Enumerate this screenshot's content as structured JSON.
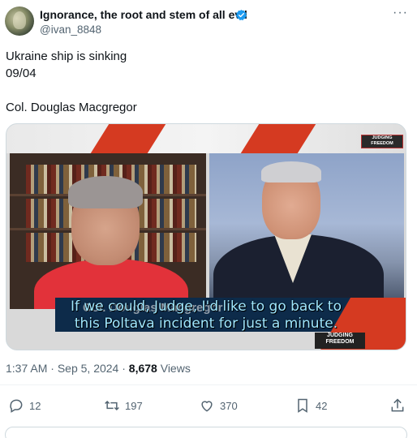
{
  "author": {
    "display_name": "Ignorance, the root and stem of all evil",
    "handle": "@ivan_8848",
    "verified": true
  },
  "menu": {
    "more_icon": "more-horizontal-icon",
    "more_label": "···"
  },
  "tweet": {
    "lines": [
      "Ukraine ship is sinking",
      "09/04",
      "Col. Douglas Macgregor"
    ]
  },
  "media": {
    "type": "video-still",
    "logo_top": "JUDGING FREEDOM",
    "lower_third_name": "Col. Douglas Macgregor",
    "subtitle_line1": "If we could, Judge, I'd like to go back to",
    "subtitle_line2": "this Poltava incident for just a minute.",
    "logo_bottom": "JUDGING FREEDOM"
  },
  "meta": {
    "time": "1:37 AM",
    "date": "Sep 5, 2024",
    "views_count": "8,678",
    "views_label": "Views"
  },
  "actions": {
    "replies": "12",
    "reposts": "197",
    "likes": "370",
    "bookmarks": "42"
  },
  "colors": {
    "text_primary": "#0f1419",
    "text_secondary": "#536471",
    "verified_blue": "#1d9bf0",
    "divider": "#eff3f4"
  }
}
